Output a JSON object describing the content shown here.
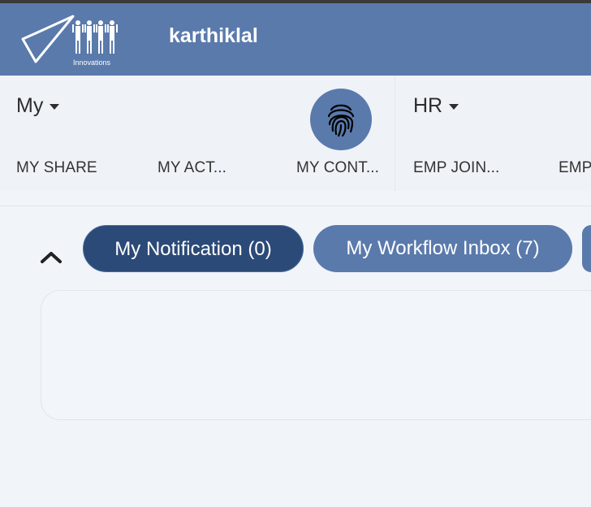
{
  "header": {
    "logo_text": "Innovations",
    "username": "karthiklal"
  },
  "menu": {
    "groups": [
      {
        "title": "My",
        "items": [
          "MY SHARE",
          "MY ACT...",
          "MY CONT..."
        ]
      },
      {
        "title": "HR",
        "items": [
          "EMP JOIN...",
          "EMP"
        ]
      }
    ],
    "fingerprint_icon": "fingerprint-icon"
  },
  "tabs": [
    {
      "label": "My Notification (0)",
      "active": true
    },
    {
      "label": "My Workflow Inbox (7)",
      "active": false
    }
  ],
  "colors": {
    "header": "#5a7aac",
    "tab_active": "#2c4a78",
    "tab_inactive": "#5a7aac",
    "background": "#f1f4f9"
  }
}
